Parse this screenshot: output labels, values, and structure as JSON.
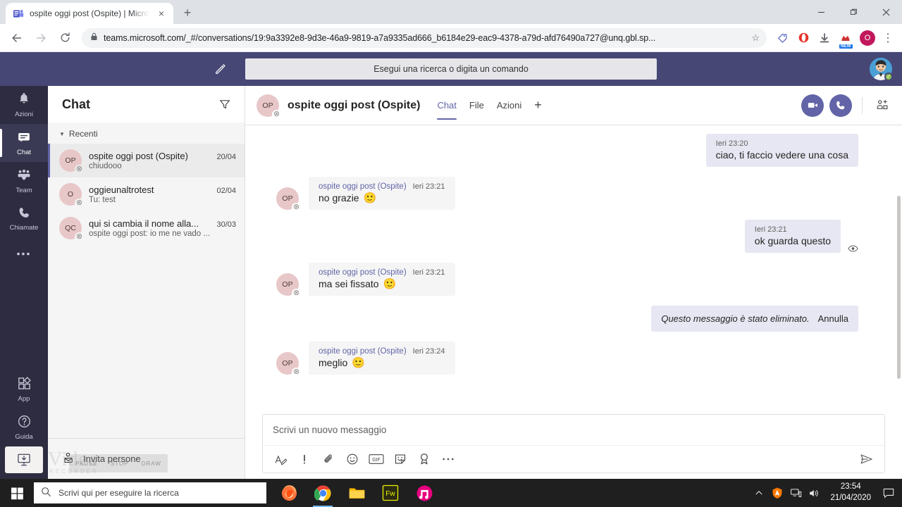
{
  "browser": {
    "tab": {
      "title": "ospite oggi post (Ospite) | Micro",
      "favicon_name": "teams-favicon",
      "close_label": "×"
    },
    "new_tab_label": "+",
    "window_controls": {
      "minimize": "—",
      "maximize": "❐",
      "close": "✕"
    },
    "nav": {
      "back": "←",
      "forward": "→",
      "reload": "↻"
    },
    "url": "teams.microsoft.com/_#/conversations/19:9a3392e8-9d3e-46a9-9819-a7a9335ad666_b6184e29-eac9-4378-a79d-afd76490a727@unq.gbl.sp...",
    "lock_icon": "lock-icon",
    "star": "☆",
    "extensions": [
      {
        "name": "tag-extension-icon",
        "color": "#5c6bc0"
      },
      {
        "name": "opera-extension-icon",
        "color": "#e63329"
      },
      {
        "name": "download-icon",
        "color": "#5f6368"
      },
      {
        "name": "lastpass-extension-icon",
        "color": "#d32f2f",
        "badge": "NEW"
      }
    ],
    "profile_initial": "O",
    "menu": "⋮"
  },
  "teams": {
    "topbar": {
      "compose_icon": "new-chat-icon",
      "search_placeholder": "Esegui una ricerca o digita un comando",
      "avatar_name": "user-avatar",
      "presence": "available"
    },
    "rail": [
      {
        "label": "Azioni",
        "icon": "bell-icon",
        "active": false
      },
      {
        "label": "Chat",
        "icon": "chat-icon",
        "active": true
      },
      {
        "label": "Team",
        "icon": "team-icon",
        "active": false
      },
      {
        "label": "Chiamate",
        "icon": "phone-icon",
        "active": false
      }
    ],
    "rail_more": "•••",
    "rail_bottom": [
      {
        "label": "App",
        "icon": "apps-icon"
      },
      {
        "label": "Guida",
        "icon": "help-icon"
      }
    ],
    "rail_download_icon": "download-app-icon",
    "chatlist": {
      "title": "Chat",
      "filter_icon": "filter-icon",
      "section_label": "Recenti",
      "items": [
        {
          "initials": "OP",
          "name": "ospite oggi post (Ospite)",
          "date": "20/04",
          "preview": "chiudooo",
          "selected": true
        },
        {
          "initials": "O",
          "name": "oggieunaltrotest",
          "date": "02/04",
          "preview": "Tu: test",
          "selected": false
        },
        {
          "initials": "QC",
          "name": "qui si cambia il nome alla...",
          "date": "30/03",
          "preview": "ospite oggi post: io me ne vado ...",
          "selected": false
        }
      ],
      "invite_label": "Invita persone",
      "invite_icon": "invite-people-icon",
      "overlay_buttons": [
        "PAUSE",
        "STOP",
        "DRAW"
      ],
      "watermark": "Video",
      "watermark_sub": "RECORDER"
    },
    "conversation": {
      "avatar_initials": "OP",
      "title": "ospite oggi post (Ospite)",
      "tabs": [
        {
          "label": "Chat",
          "active": true
        },
        {
          "label": "File",
          "active": false
        },
        {
          "label": "Azioni",
          "active": false
        }
      ],
      "add_tab_label": "+",
      "video_call_icon": "video-call-icon",
      "audio_call_icon": "audio-call-icon",
      "add_people_icon": "add-people-icon",
      "messages": [
        {
          "direction": "out",
          "time": "Ieri 23:20",
          "text": "ciao, ti faccio vedere una cosa",
          "emoji": "",
          "seen": false
        },
        {
          "direction": "in",
          "author": "ospite oggi post (Ospite)",
          "time": "Ieri 23:21",
          "text": "no grazie",
          "emoji": "🙂",
          "avatar": "OP"
        },
        {
          "direction": "out",
          "time": "Ieri 23:21",
          "text": "ok guarda questo",
          "emoji": "",
          "seen": true
        },
        {
          "direction": "in",
          "author": "ospite oggi post (Ospite)",
          "time": "Ieri 23:21",
          "text": "ma sei fissato",
          "emoji": "🙂",
          "avatar": "OP"
        },
        {
          "direction": "out",
          "deleted": true,
          "text": "Questo messaggio è stato eliminato.",
          "undo": "Annulla"
        },
        {
          "direction": "in",
          "author": "ospite oggi post (Ospite)",
          "time": "Ieri 23:24",
          "text": "meglio",
          "emoji": "🙂",
          "avatar": "OP"
        }
      ],
      "compose_placeholder": "Scrivi un nuovo messaggio",
      "tools": [
        {
          "name": "format-icon",
          "glyph": "A"
        },
        {
          "name": "important-icon",
          "glyph": "!"
        },
        {
          "name": "attach-icon",
          "glyph": "📎"
        },
        {
          "name": "emoji-icon",
          "glyph": "☺"
        },
        {
          "name": "gif-icon",
          "glyph": "GIF"
        },
        {
          "name": "sticker-icon",
          "glyph": "⚑"
        },
        {
          "name": "praise-icon",
          "glyph": "❀"
        },
        {
          "name": "more-options-icon",
          "glyph": "⋯"
        }
      ],
      "send_icon": "send-icon"
    }
  },
  "taskbar": {
    "start_icon": "windows-start-icon",
    "search_placeholder": "Scrivi qui per eseguire la ricerca",
    "search_icon": "search-icon",
    "apps": [
      {
        "name": "firefox-taskbar-icon",
        "running": false
      },
      {
        "name": "chrome-taskbar-icon",
        "running": true
      },
      {
        "name": "file-explorer-taskbar-icon",
        "running": false
      },
      {
        "name": "fireworks-taskbar-icon",
        "running": false,
        "label": "Fw"
      },
      {
        "name": "music-app-taskbar-icon",
        "running": false
      }
    ],
    "tray": [
      {
        "name": "show-hidden-icons",
        "glyph": "⌃"
      },
      {
        "name": "avast-tray-icon"
      },
      {
        "name": "network-tray-icon"
      },
      {
        "name": "volume-tray-icon"
      }
    ],
    "time": "23:54",
    "date": "21/04/2020",
    "action_center_icon": "action-center-icon"
  },
  "colors": {
    "teams_purple": "#6264a7",
    "teams_topbar": "#464775",
    "rail_bg": "#2d2c40",
    "out_bubble": "#e7e7f3",
    "in_bubble": "#f5f5f5",
    "presence_green": "#92c353"
  }
}
